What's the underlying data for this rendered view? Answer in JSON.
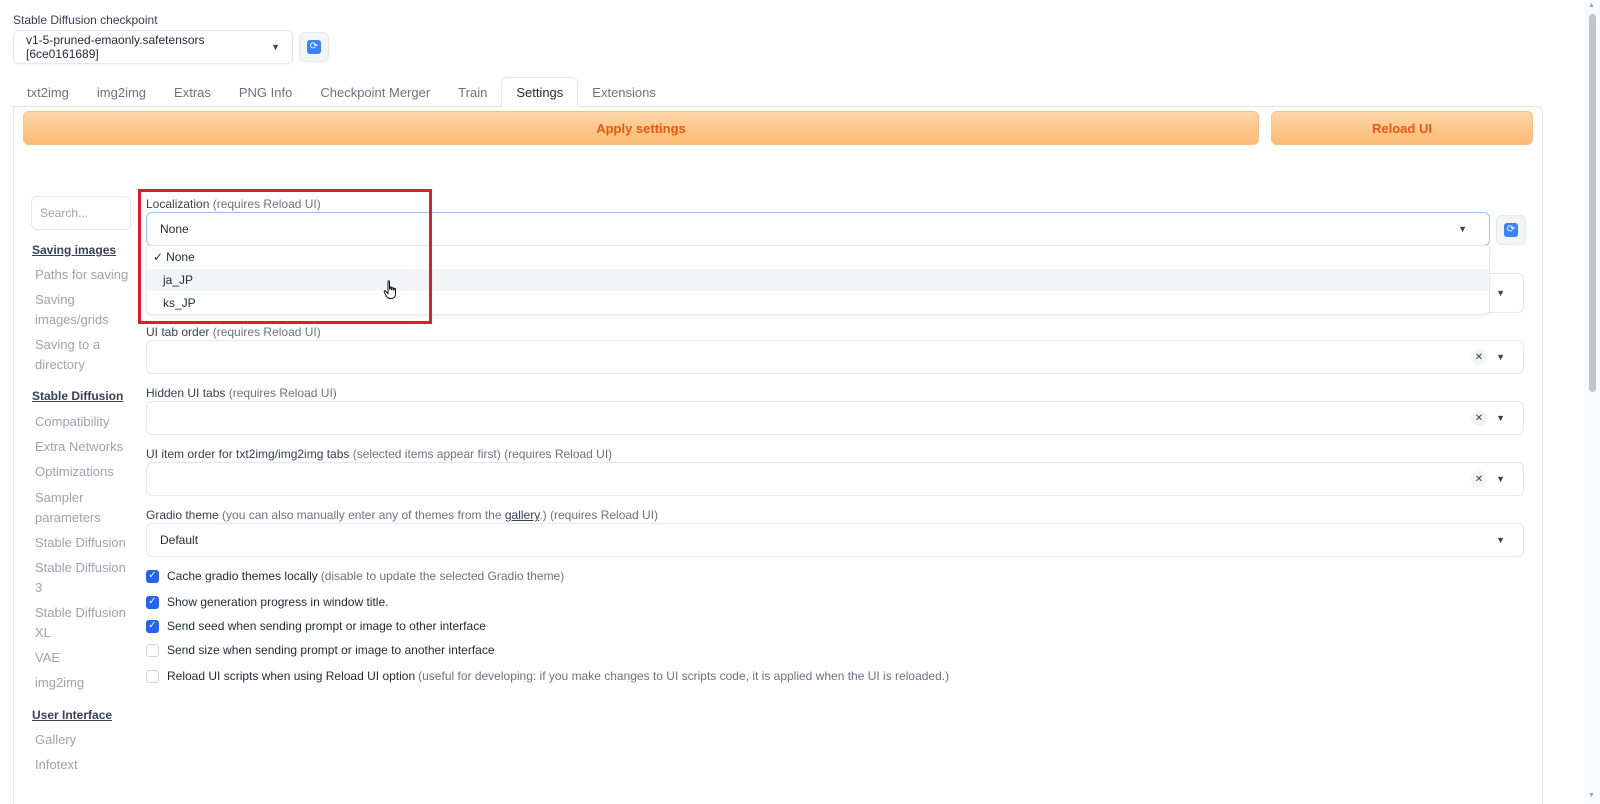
{
  "checkpoint": {
    "label": "Stable Diffusion checkpoint",
    "value": "v1-5-pruned-emaonly.safetensors [6ce0161689]"
  },
  "tabs": [
    "txt2img",
    "img2img",
    "Extras",
    "PNG Info",
    "Checkpoint Merger",
    "Train",
    "Settings",
    "Extensions"
  ],
  "active_tab": "Settings",
  "buttons": {
    "apply": "Apply settings",
    "reload": "Reload UI"
  },
  "sidebar": {
    "search_placeholder": "Search...",
    "sections": [
      {
        "title": "Saving images",
        "items": [
          "Paths for saving",
          "Saving images/grids",
          "Saving to a directory"
        ]
      },
      {
        "title": "Stable Diffusion",
        "items": [
          "Compatibility",
          "Extra Networks",
          "Optimizations",
          "Sampler parameters",
          "Stable Diffusion",
          "Stable Diffusion 3",
          "Stable Diffusion XL",
          "VAE",
          "img2img"
        ]
      },
      {
        "title": "User Interface",
        "items": [
          "Gallery",
          "Infotext"
        ]
      }
    ]
  },
  "settings": {
    "localization": {
      "label": "Localization",
      "note": "(requires Reload UI)",
      "value": "None",
      "options": [
        "None",
        "ja_JP",
        "ks_JP"
      ],
      "checkmark": "✓"
    },
    "tab_order": {
      "label": "UI tab order",
      "note": "(requires Reload UI)"
    },
    "hidden_tabs": {
      "label": "Hidden UI tabs",
      "note": "(requires Reload UI)"
    },
    "item_order": {
      "label": "UI item order for txt2img/img2img tabs",
      "note": "(selected items appear first) (requires Reload UI)"
    },
    "gradio_theme": {
      "label": "Gradio theme",
      "note_pre": "(you can also manually enter any of themes from the",
      "link": "gallery",
      "note_post": ".) (requires Reload UI)",
      "value": "Default"
    },
    "checkboxes": [
      {
        "label": "Cache gradio themes locally",
        "note": "(disable to update the selected Gradio theme)",
        "checked": true
      },
      {
        "label": "Show generation progress in window title.",
        "note": "",
        "checked": true
      },
      {
        "label": "Send seed when sending prompt or image to other interface",
        "note": "",
        "checked": true
      },
      {
        "label": "Send size when sending prompt or image to another interface",
        "note": "",
        "checked": false
      },
      {
        "label": "Reload UI scripts when using Reload UI option",
        "note": "(useful for developing: if you make changes to UI scripts code, it is applied when the UI is reloaded.)",
        "checked": false
      }
    ]
  },
  "icons": {
    "refresh": "refresh-icon",
    "caret": "caret-down-icon",
    "clear": "clear-icon",
    "check": "checkmark-icon",
    "cursor": "hand-cursor-icon"
  },
  "colors": {
    "accent": "#ea580c",
    "highlight_box": "#e11d2a",
    "checkbox_on": "#2563eb"
  }
}
